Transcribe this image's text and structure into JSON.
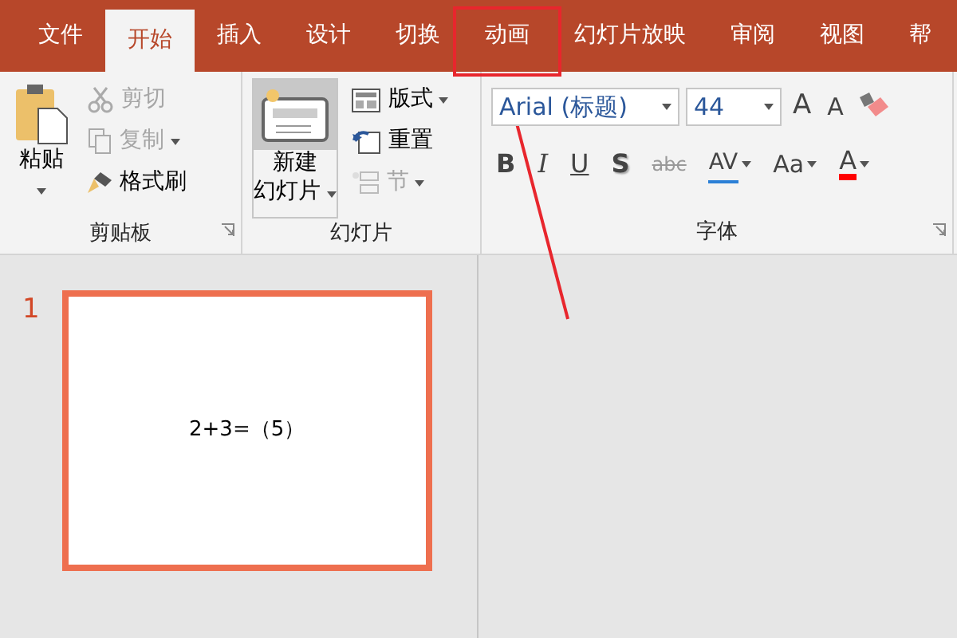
{
  "tabs": [
    {
      "label": "文件",
      "selected": false,
      "annotated": false
    },
    {
      "label": "开始",
      "selected": true,
      "annotated": false
    },
    {
      "label": "插入",
      "selected": false,
      "annotated": false
    },
    {
      "label": "设计",
      "selected": false,
      "annotated": false
    },
    {
      "label": "切换",
      "selected": false,
      "annotated": false
    },
    {
      "label": "动画",
      "selected": false,
      "annotated": true
    },
    {
      "label": "幻灯片放映",
      "selected": false,
      "annotated": false
    },
    {
      "label": "审阅",
      "selected": false,
      "annotated": false
    },
    {
      "label": "视图",
      "selected": false,
      "annotated": false
    },
    {
      "label": "帮",
      "selected": false,
      "annotated": false
    }
  ],
  "ribbon": {
    "groups": [
      {
        "kind": "clipboard",
        "label": "剪贴板",
        "launcher": true,
        "big_button": {
          "kind": "paste",
          "lines": [
            "粘贴"
          ],
          "dropdown": true,
          "pressed": false
        },
        "items": [
          {
            "kind": "cut",
            "label": "剪切",
            "disabled": true,
            "dropdown": false
          },
          {
            "kind": "copy",
            "label": "复制",
            "disabled": true,
            "dropdown": true
          },
          {
            "kind": "painter",
            "label": "格式刷",
            "disabled": false,
            "dropdown": false
          }
        ]
      },
      {
        "kind": "slides",
        "label": "幻灯片",
        "launcher": false,
        "big_button": {
          "kind": "new-slide",
          "lines": [
            "新建",
            "幻灯片"
          ],
          "dropdown": true,
          "pressed": true
        },
        "items": [
          {
            "kind": "layout",
            "label": "版式",
            "disabled": false,
            "dropdown": true
          },
          {
            "kind": "reset",
            "label": "重置",
            "disabled": false,
            "dropdown": false
          },
          {
            "kind": "section",
            "label": "节",
            "disabled": true,
            "dropdown": true
          }
        ]
      },
      {
        "kind": "font",
        "label": "字体",
        "launcher": true,
        "font_name": "Arial (标题)",
        "font_size": "44",
        "size_buttons": [
          {
            "kind": "grow",
            "label": "A"
          },
          {
            "kind": "shrink",
            "label": "A"
          }
        ],
        "format_buttons": [
          {
            "kind": "bold",
            "label": "B",
            "dropdown": false
          },
          {
            "kind": "italic",
            "label": "I",
            "dropdown": false
          },
          {
            "kind": "underline",
            "label": "U",
            "dropdown": false
          },
          {
            "kind": "shadow",
            "label": "S",
            "dropdown": false
          },
          {
            "kind": "strike",
            "label": "abc",
            "dropdown": false
          },
          {
            "kind": "spacing",
            "label": "AV",
            "dropdown": true
          },
          {
            "kind": "case",
            "label": "Aa",
            "dropdown": true
          },
          {
            "kind": "color",
            "label": "A",
            "dropdown": true,
            "color": "#ff0000"
          }
        ]
      }
    ]
  },
  "slide_panel": {
    "slides": [
      {
        "number": "1",
        "selected": true,
        "text": "2+3=（5）"
      }
    ]
  }
}
